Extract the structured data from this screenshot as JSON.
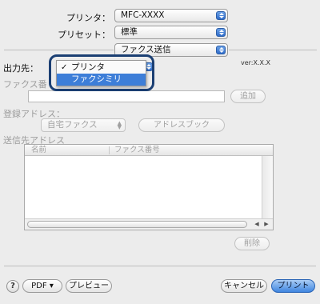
{
  "printer": {
    "label": "プリンタ：",
    "value": "MFC-XXXX"
  },
  "preset": {
    "label": "プリセット：",
    "value": "標準"
  },
  "panel": {
    "value": "ファクス送信"
  },
  "version": "ver:X.X.X",
  "output": {
    "label": "出力先：",
    "menu_items": [
      {
        "label": "プリンタ",
        "checked": true
      },
      {
        "label": "ファクシミリ",
        "selected": true
      }
    ]
  },
  "fax_number": {
    "label": "ファクス番",
    "add_button": "追加"
  },
  "address": {
    "label": "登録アドレス：",
    "popup_value": "自宅ファクス",
    "book_button": "アドレスブック"
  },
  "recipients": {
    "label": "送信先アドレス",
    "columns": [
      "名前",
      "ファクス番号"
    ],
    "delete_button": "削除"
  },
  "footer": {
    "help": "?",
    "pdf": "PDF ▾",
    "preview": "プレビュー",
    "cancel": "キャンセル",
    "print": "プリント"
  }
}
